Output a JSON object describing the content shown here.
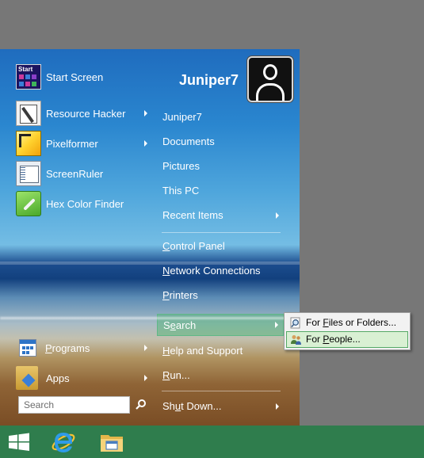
{
  "user": {
    "name": "Juniper7",
    "avatar_icon": "user-avatar-icon"
  },
  "pinned": [
    {
      "label": "Start Screen",
      "icon": "start-screen-icon",
      "submenu": false
    },
    {
      "label": "Resource Hacker",
      "icon": "resource-hacker-icon",
      "submenu": true
    },
    {
      "label": "Pixelformer",
      "icon": "pixelformer-icon",
      "submenu": true
    },
    {
      "label": "ScreenRuler",
      "icon": "screenruler-icon",
      "submenu": false
    },
    {
      "label": "Hex Color Finder",
      "icon": "hex-color-finder-icon",
      "submenu": false
    }
  ],
  "bottom": {
    "programs_label": "Programs",
    "apps_label": "Apps",
    "search_placeholder": "Search"
  },
  "places": [
    {
      "label": "Juniper7",
      "submenu": false
    },
    {
      "label": "Documents",
      "submenu": false
    },
    {
      "label": "Pictures",
      "submenu": false
    },
    {
      "label": "This PC",
      "submenu": false
    },
    {
      "label": "Recent Items",
      "submenu": true
    },
    {
      "label": "Control Panel",
      "submenu": false
    },
    {
      "label": "Network Connections",
      "submenu": false
    },
    {
      "label": "Printers",
      "submenu": false
    },
    {
      "label": "Search",
      "submenu": true,
      "active": true
    },
    {
      "label": "Help and Support",
      "submenu": false
    },
    {
      "label": "Run...",
      "submenu": false
    },
    {
      "label": "Shut Down...",
      "submenu": true
    }
  ],
  "search_submenu": [
    {
      "label": "For Files or Folders...",
      "icon": "search-files-icon"
    },
    {
      "label": "For People...",
      "icon": "people-icon",
      "highlighted": true
    }
  ],
  "taskbar": [
    {
      "name": "windows-logo-icon"
    },
    {
      "name": "internet-explorer-icon"
    },
    {
      "name": "file-explorer-icon"
    }
  ],
  "colors": {
    "taskbar": "#2f7d4d",
    "highlight": "#5fb887",
    "submenu_highlight": "#d9f0d3"
  }
}
